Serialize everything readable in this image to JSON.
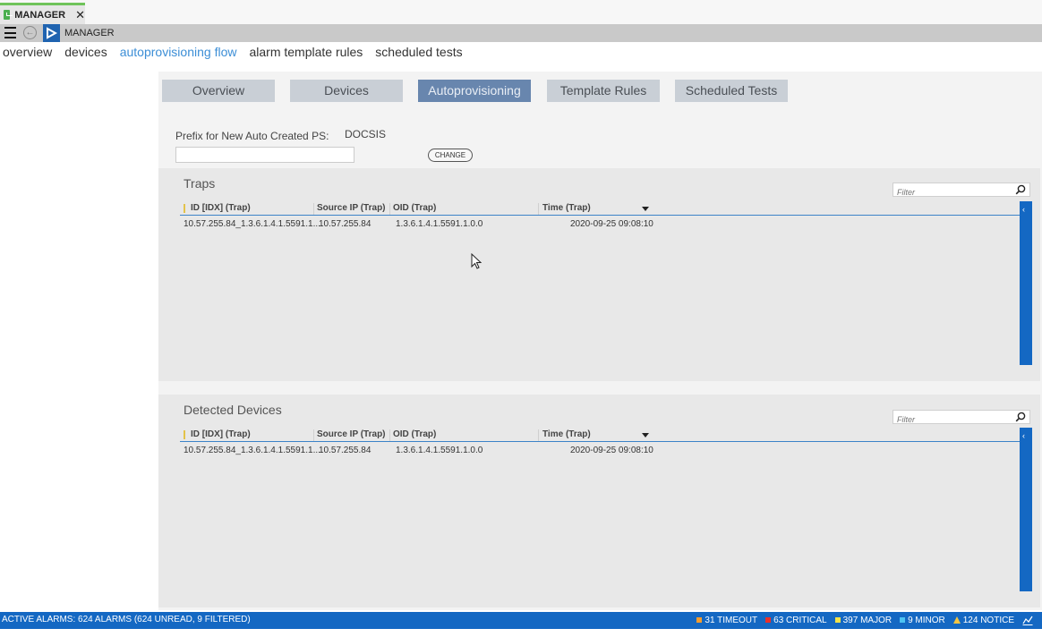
{
  "window": {
    "tab_label": "MANAGER",
    "close_glyph": "✕",
    "toolbar_title": "MANAGER"
  },
  "topnav": [
    {
      "label": "overview"
    },
    {
      "label": "devices"
    },
    {
      "label": "autoprovisioning flow",
      "active": true
    },
    {
      "label": "alarm template rules"
    },
    {
      "label": "scheduled tests"
    }
  ],
  "tabs": [
    {
      "label": "Overview"
    },
    {
      "label": "Devices"
    },
    {
      "label": "Autoprovisioning",
      "active": true
    },
    {
      "label": "Template Rules"
    },
    {
      "label": "Scheduled Tests"
    }
  ],
  "prefix": {
    "label": "Prefix for New Auto Created PS:",
    "value": "DOCSIS",
    "input_value": "",
    "change_label": "CHANGE"
  },
  "traps": {
    "title": "Traps",
    "filter_placeholder": "Filter",
    "columns": [
      "ID [IDX] (Trap)",
      "Source IP (Trap)",
      "OID (Trap)",
      "Time (Trap)"
    ],
    "rows": [
      {
        "id": "10.57.255.84_1.3.6.1.4.1.5591.1....",
        "source_ip": "10.57.255.84",
        "oid": "1.3.6.1.4.1.5591.1.0.0",
        "time": "2020-09-25 09:08:10"
      }
    ]
  },
  "detected": {
    "title": "Detected Devices",
    "filter_placeholder": "Filter",
    "columns": [
      "ID [IDX] (Trap)",
      "Source IP (Trap)",
      "OID (Trap)",
      "Time (Trap)"
    ],
    "rows": [
      {
        "id": "10.57.255.84_1.3.6.1.4.1.5591.1....",
        "source_ip": "10.57.255.84",
        "oid": "1.3.6.1.4.1.5591.1.0.0",
        "time": "2020-09-25 09:08:10"
      }
    ]
  },
  "statusbar": {
    "text": "ACTIVE ALARMS: 624 ALARMS (624 UNREAD, 9 FILTERED)",
    "severities": [
      {
        "label": "31 TIMEOUT",
        "color": "#f39c2f",
        "icon": "square"
      },
      {
        "label": "63 CRITICAL",
        "color": "#e8302b",
        "icon": "square"
      },
      {
        "label": "397 MAJOR",
        "color": "#f2e24a",
        "icon": "square"
      },
      {
        "label": "9 MINOR",
        "color": "#4cc3f2",
        "icon": "square"
      },
      {
        "label": "124 NOTICE",
        "color": "#f4c542",
        "icon": "warning-triangle"
      }
    ]
  },
  "colors": {
    "accent": "#1468c3",
    "active_tab": "#6886ae",
    "nav_active": "#3c8ed6",
    "title_accent": "#6fc35a"
  }
}
